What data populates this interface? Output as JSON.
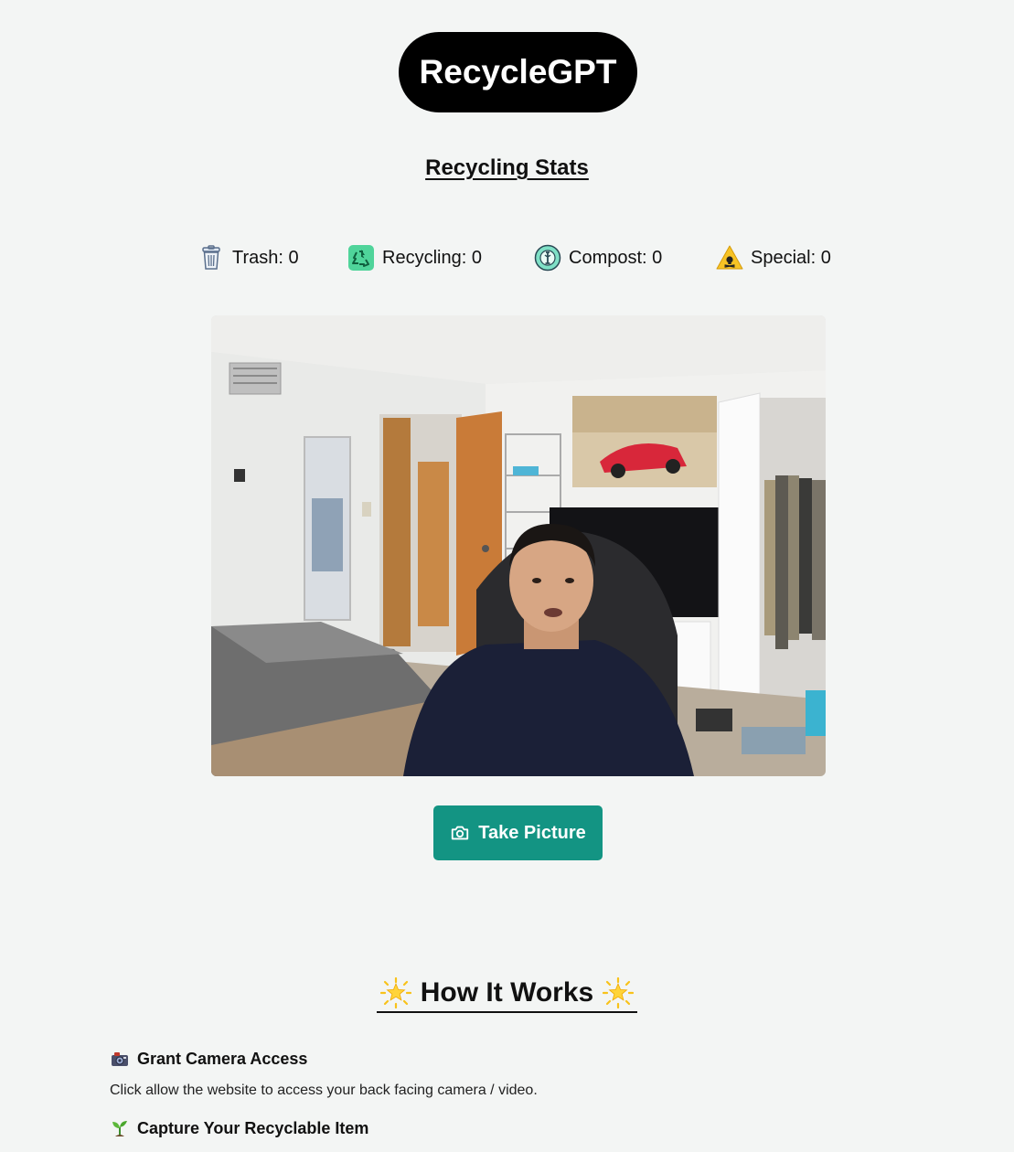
{
  "header": {
    "brand": "RecycleGPT"
  },
  "stats": {
    "title": "Recycling Stats",
    "items": [
      {
        "label": "Trash: 0",
        "icon": "trash-can-icon"
      },
      {
        "label": "Recycling: 0",
        "icon": "recycle-icon"
      },
      {
        "label": "Compost: 0",
        "icon": "compost-icon"
      },
      {
        "label": "Special: 0",
        "icon": "hazard-icon"
      }
    ]
  },
  "camera": {
    "feed": "webcam-video-preview"
  },
  "actions": {
    "take_picture": "Take Picture",
    "take_picture_icon": "camera-icon"
  },
  "how_it_works": {
    "title": "How It Works",
    "steps": [
      {
        "title": "Grant Camera Access",
        "icon": "video-camera-icon",
        "description": "Click allow the website to access your back facing camera / video."
      },
      {
        "title": "Capture Your Recyclable Item",
        "icon": "seedling-icon"
      }
    ]
  },
  "colors": {
    "accent": "#139483",
    "brand_bg": "#000000",
    "page_bg": "#f3f5f4"
  }
}
